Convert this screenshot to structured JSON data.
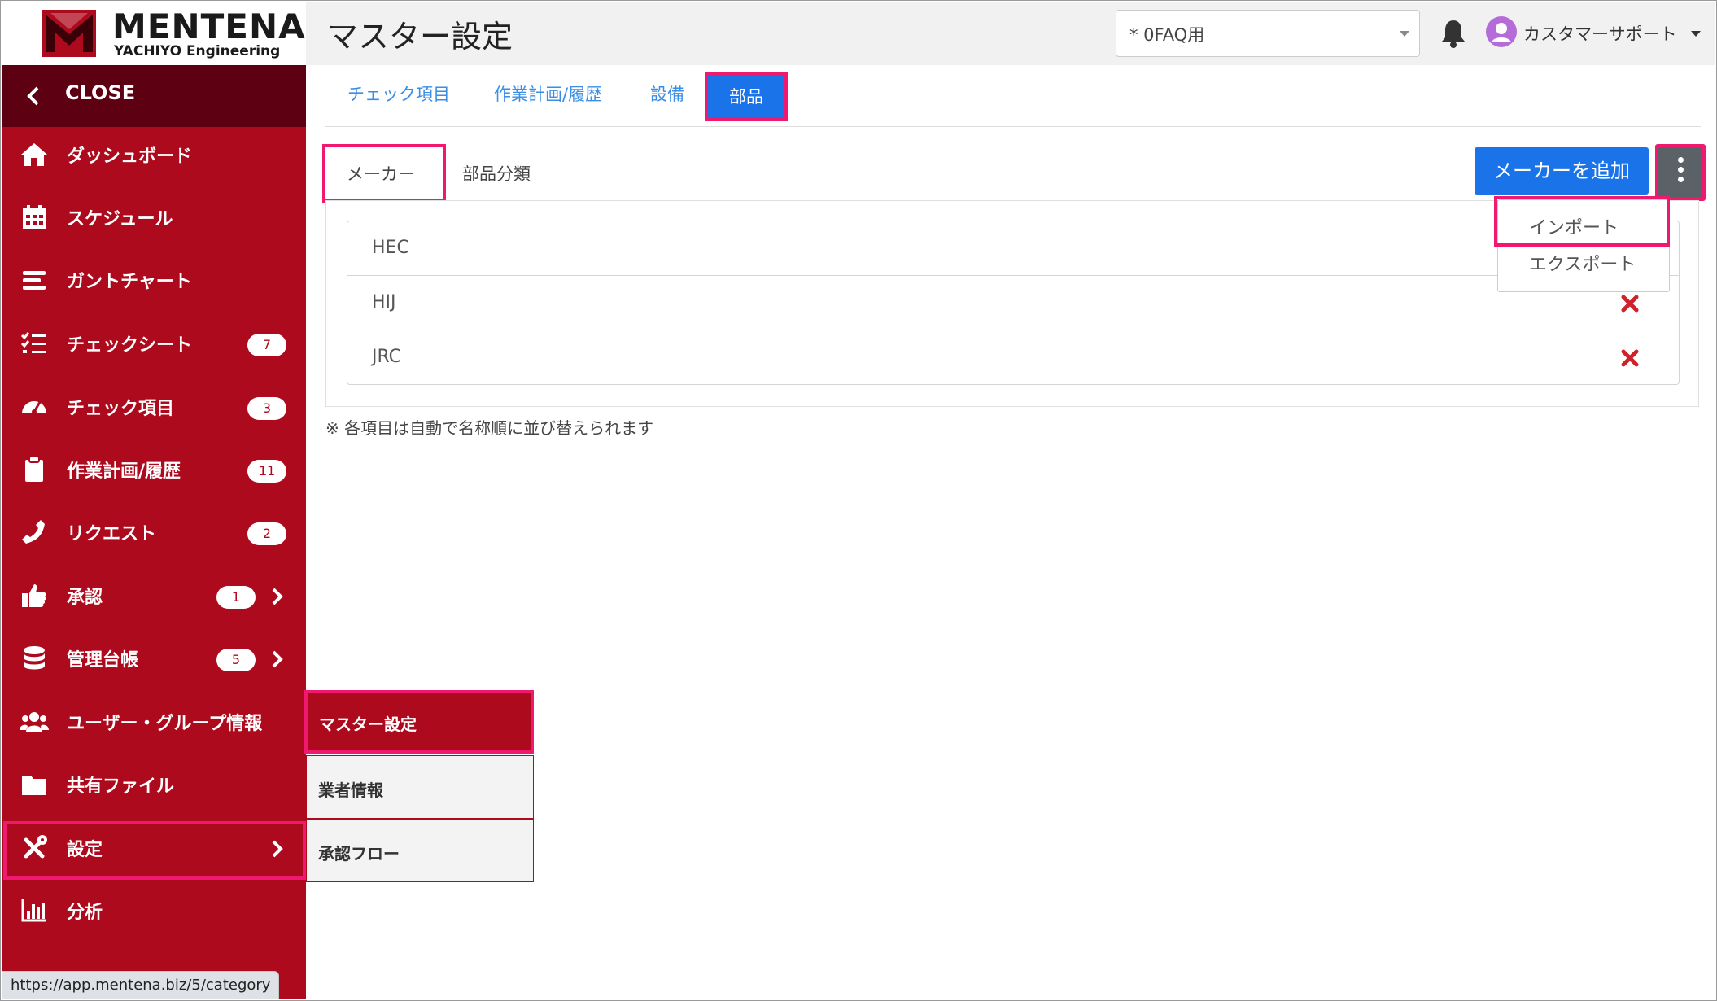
{
  "brand": {
    "title": "MENTENA",
    "subtitle": "YACHIYO Engineering"
  },
  "sidebar": {
    "close_label": "CLOSE",
    "items": [
      {
        "label": "ダッシュボード",
        "icon": "home-icon",
        "badge": ""
      },
      {
        "label": "スケジュール",
        "icon": "calendar-icon",
        "badge": ""
      },
      {
        "label": "ガントチャート",
        "icon": "gantt-icon",
        "badge": ""
      },
      {
        "label": "チェックシート",
        "icon": "checklist-icon",
        "badge": "7"
      },
      {
        "label": "チェック項目",
        "icon": "gauge-icon",
        "badge": "3"
      },
      {
        "label": "作業計画/履歴",
        "icon": "clipboard-icon",
        "badge": "11"
      },
      {
        "label": "リクエスト",
        "icon": "phone-icon",
        "badge": "2"
      },
      {
        "label": "承認",
        "icon": "thumbs-up-icon",
        "badge": "1"
      },
      {
        "label": "管理台帳",
        "icon": "database-icon",
        "badge": "5"
      },
      {
        "label": "ユーザー・グループ情報",
        "icon": "users-icon",
        "badge": ""
      },
      {
        "label": "共有ファイル",
        "icon": "folder-icon",
        "badge": ""
      },
      {
        "label": "設定",
        "icon": "tools-icon",
        "badge": ""
      },
      {
        "label": "分析",
        "icon": "bar-chart-icon",
        "badge": ""
      }
    ]
  },
  "submenu": {
    "items": [
      "マスター設定",
      "業者情報",
      "承認フロー"
    ]
  },
  "status_url": "https://app.mentena.biz/5/category",
  "header": {
    "title": "マスター設定",
    "selector_value": "* 0FAQ用",
    "user_name": "カスタマーサポート"
  },
  "tabs": [
    "チェック項目",
    "作業計画/履歴",
    "設備",
    "部品"
  ],
  "subtabs": [
    "メーカー",
    "部品分類"
  ],
  "add_button": "メーカーを追加",
  "dropdown": [
    "インポート",
    "エクスポート"
  ],
  "makers": [
    "HEC",
    "HIJ",
    "JRC"
  ],
  "note": "※ 各項目は自動で名称順に並び替えられます",
  "colors": {
    "sidebar": "#ad0a1d",
    "sidebar_dark": "#5c0012",
    "primary": "#1a73e8",
    "highlight": "#f0186f",
    "delete": "#d0212b"
  }
}
